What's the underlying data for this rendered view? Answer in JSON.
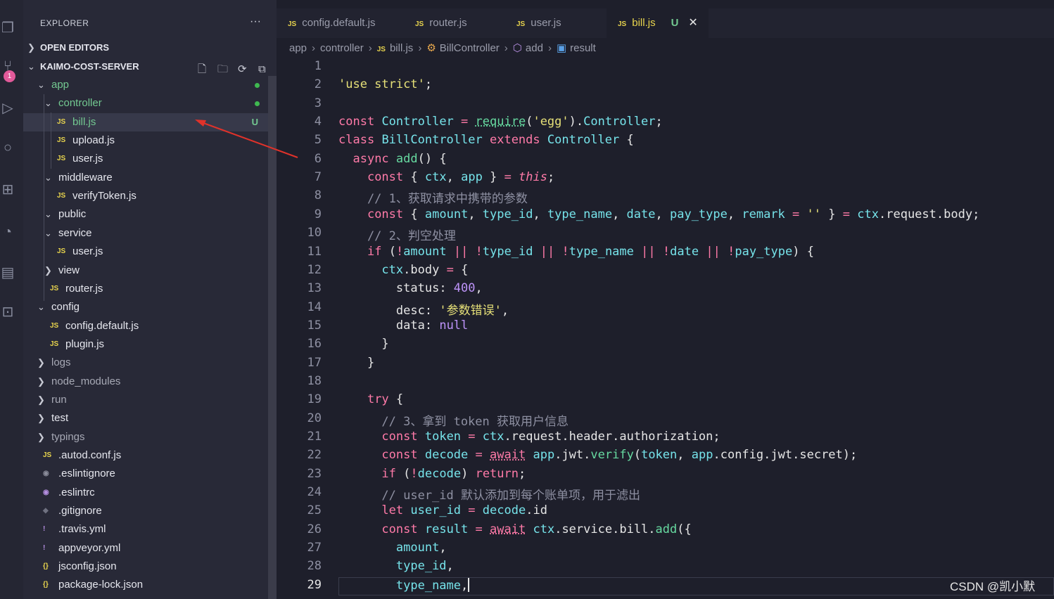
{
  "sidebar": {
    "title": "EXPLORER",
    "more": "···",
    "open_editors": "OPEN EDITORS",
    "project": "KAIMO-COST-SERVER",
    "tree": [
      {
        "name": "app",
        "type": "folder",
        "open": true,
        "depth": 1,
        "modified": true
      },
      {
        "name": "controller",
        "type": "folder",
        "open": true,
        "depth": 2,
        "modified": true
      },
      {
        "name": "bill.js",
        "type": "js",
        "depth": 3,
        "status": "U",
        "selected": true
      },
      {
        "name": "upload.js",
        "type": "js",
        "depth": 3
      },
      {
        "name": "user.js",
        "type": "js",
        "depth": 3
      },
      {
        "name": "middleware",
        "type": "folder",
        "open": true,
        "depth": 2
      },
      {
        "name": "verifyToken.js",
        "type": "js",
        "depth": 3
      },
      {
        "name": "public",
        "type": "folder",
        "open": true,
        "depth": 2
      },
      {
        "name": "service",
        "type": "folder",
        "open": true,
        "depth": 2
      },
      {
        "name": "user.js",
        "type": "js",
        "depth": 3
      },
      {
        "name": "view",
        "type": "folder",
        "open": false,
        "depth": 2
      },
      {
        "name": "router.js",
        "type": "js",
        "depth": 2
      },
      {
        "name": "config",
        "type": "folder",
        "open": true,
        "depth": 1
      },
      {
        "name": "config.default.js",
        "type": "js",
        "depth": 2
      },
      {
        "name": "plugin.js",
        "type": "js",
        "depth": 2
      },
      {
        "name": "logs",
        "type": "folder",
        "open": false,
        "depth": 1,
        "dim": true
      },
      {
        "name": "node_modules",
        "type": "folder",
        "open": false,
        "depth": 1,
        "dim": true
      },
      {
        "name": "run",
        "type": "folder",
        "open": false,
        "depth": 1,
        "dim": true
      },
      {
        "name": "test",
        "type": "folder",
        "open": false,
        "depth": 1
      },
      {
        "name": "typings",
        "type": "folder",
        "open": false,
        "depth": 1,
        "dim": true
      },
      {
        "name": ".autod.conf.js",
        "type": "js",
        "depth": 1
      },
      {
        "name": ".eslintignore",
        "type": "eslintignore",
        "depth": 1
      },
      {
        "name": ".eslintrc",
        "type": "eslintrc",
        "depth": 1
      },
      {
        "name": ".gitignore",
        "type": "git",
        "depth": 1
      },
      {
        "name": ".travis.yml",
        "type": "yml",
        "depth": 1
      },
      {
        "name": "appveyor.yml",
        "type": "yml",
        "depth": 1
      },
      {
        "name": "jsconfig.json",
        "type": "json",
        "depth": 1
      },
      {
        "name": "package-lock.json",
        "type": "json",
        "depth": 1
      }
    ]
  },
  "tabs": [
    {
      "label": "config.default.js"
    },
    {
      "label": "router.js"
    },
    {
      "label": "user.js"
    },
    {
      "label": "bill.js",
      "active": true,
      "status": "U"
    }
  ],
  "breadcrumb": [
    "app",
    "controller",
    "bill.js",
    "BillController",
    "add",
    "result"
  ],
  "icons": {
    "js": "JS",
    "close": "✕"
  },
  "editor": {
    "current_line": 29,
    "lines": [
      "",
      "'use strict';",
      "",
      "const Controller = require('egg').Controller;",
      "class BillController extends Controller {",
      "  async add() {",
      "    const { ctx, app } = this;",
      "    // 1、获取请求中携带的参数",
      "    const { amount, type_id, type_name, date, pay_type, remark = '' } = ctx.request.body;",
      "    // 2、判空处理",
      "    if (!amount || !type_id || !type_name || !date || !pay_type) {",
      "      ctx.body = {",
      "        status: 400,",
      "        desc: '参数错误',",
      "        data: null",
      "      }",
      "    }",
      "",
      "    try {",
      "      // 3、拿到 token 获取用户信息",
      "      const token = ctx.request.header.authorization;",
      "      const decode = await app.jwt.verify(token, app.config.jwt.secret);",
      "      if (!decode) return;",
      "      // user_id 默认添加到每个账单项，用于滤出",
      "      let user_id = decode.id",
      "      const result = await ctx.service.bill.add({",
      "        amount,",
      "        type_id,",
      "        type_name,"
    ]
  },
  "watermark": "CSDN @凯小默",
  "colors": {
    "accent": "#e8d44d",
    "untracked": "#73c991",
    "keyword": "#ff7aa8",
    "string": "#e6e078"
  }
}
